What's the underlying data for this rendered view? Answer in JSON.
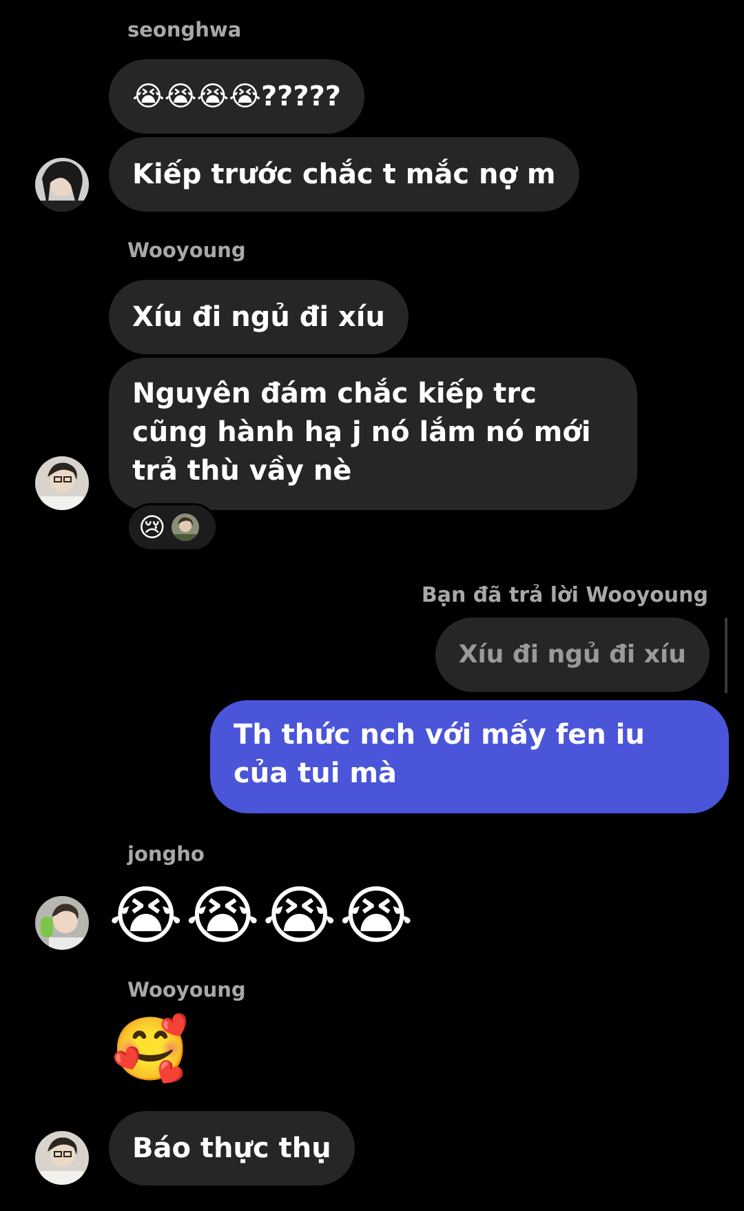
{
  "messages": {
    "m1": {
      "sender": "seonghwa",
      "text1": "😭😭😭😭?????",
      "text2": "Kiếp trước chắc t mắc nợ m"
    },
    "m2": {
      "sender": "Wooyoung",
      "text1": "Xíu đi ngủ đi xíu",
      "text2": "Nguyên đám chắc kiếp trc cũng hành hạ j nó lắm nó mới trả thù vầy nè",
      "reaction_emoji": "😢"
    },
    "reply": {
      "header": "Bạn đã trả lời Wooyoung",
      "quoted": "Xíu đi ngủ đi xíu",
      "text": "Th thức nch với mấy fen iu của tui mà"
    },
    "m3": {
      "sender": "jongho",
      "emojis": "😭😭😭😭"
    },
    "m4": {
      "sender": "Wooyoung",
      "emoji": "🥰",
      "text": "Báo thực thụ"
    }
  },
  "colors": {
    "background": "#000000",
    "incoming_bubble": "#262626",
    "outgoing_bubble": "#4b55d9",
    "sender_name": "#a8a8a8"
  }
}
